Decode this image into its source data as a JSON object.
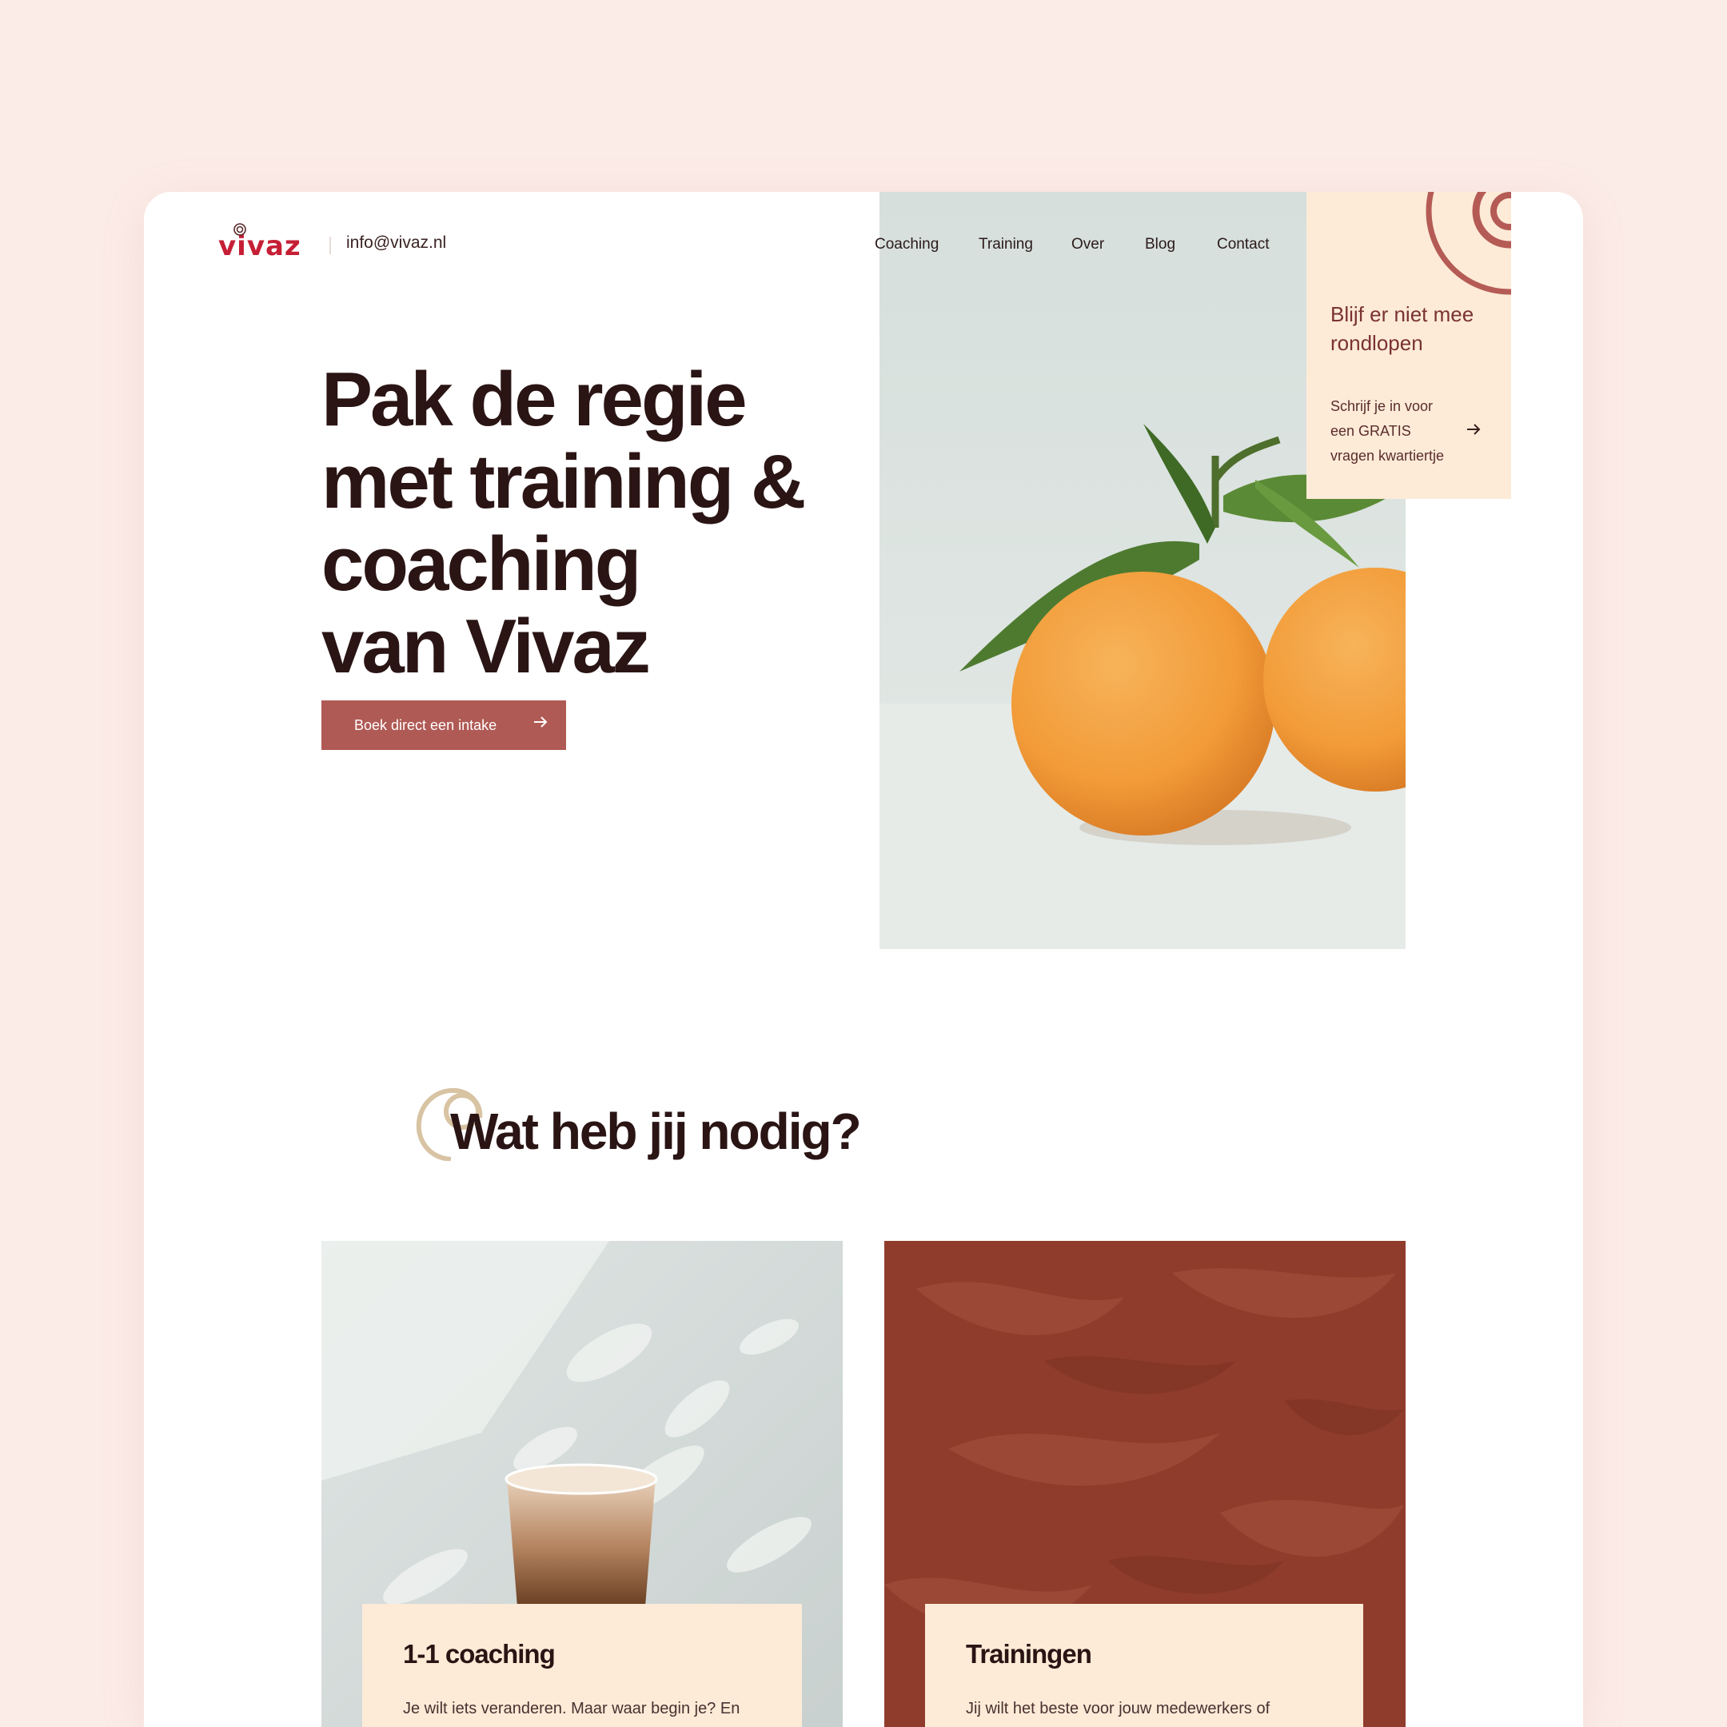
{
  "header": {
    "logo_text": "vivaz",
    "email": "info@vivaz.nl",
    "nav": [
      "Coaching",
      "Training",
      "Over",
      "Blog",
      "Contact"
    ]
  },
  "hero": {
    "title_lines": [
      "Pak de regie",
      "met training &",
      "coaching",
      "van Vivaz"
    ],
    "cta_label": "Boek direct een intake"
  },
  "promo": {
    "title": "Blijf er niet mee rondlopen",
    "text": "Schrijf je in voor een GRATIS vragen kwartiertje"
  },
  "section": {
    "title": "Wat heb jij nodig?"
  },
  "cards": [
    {
      "title": "1-1 coaching",
      "text": "Je wilt iets veranderen. Maar waar begin je? En"
    },
    {
      "title": "Trainingen",
      "text": "Jij wilt het beste voor jouw medewerkers of"
    }
  ],
  "colors": {
    "page_bg": "#fcece8",
    "brand_red": "#c61f35",
    "cta_bg": "#b05a55",
    "cream": "#fdebd7",
    "dark_text": "#2a1414",
    "swirl_tan": "#d8c3a3"
  },
  "icons": {
    "cta_arrow": "arrow-right-icon",
    "promo_arrow": "arrow-right-icon",
    "decor": "swirl-icon"
  }
}
